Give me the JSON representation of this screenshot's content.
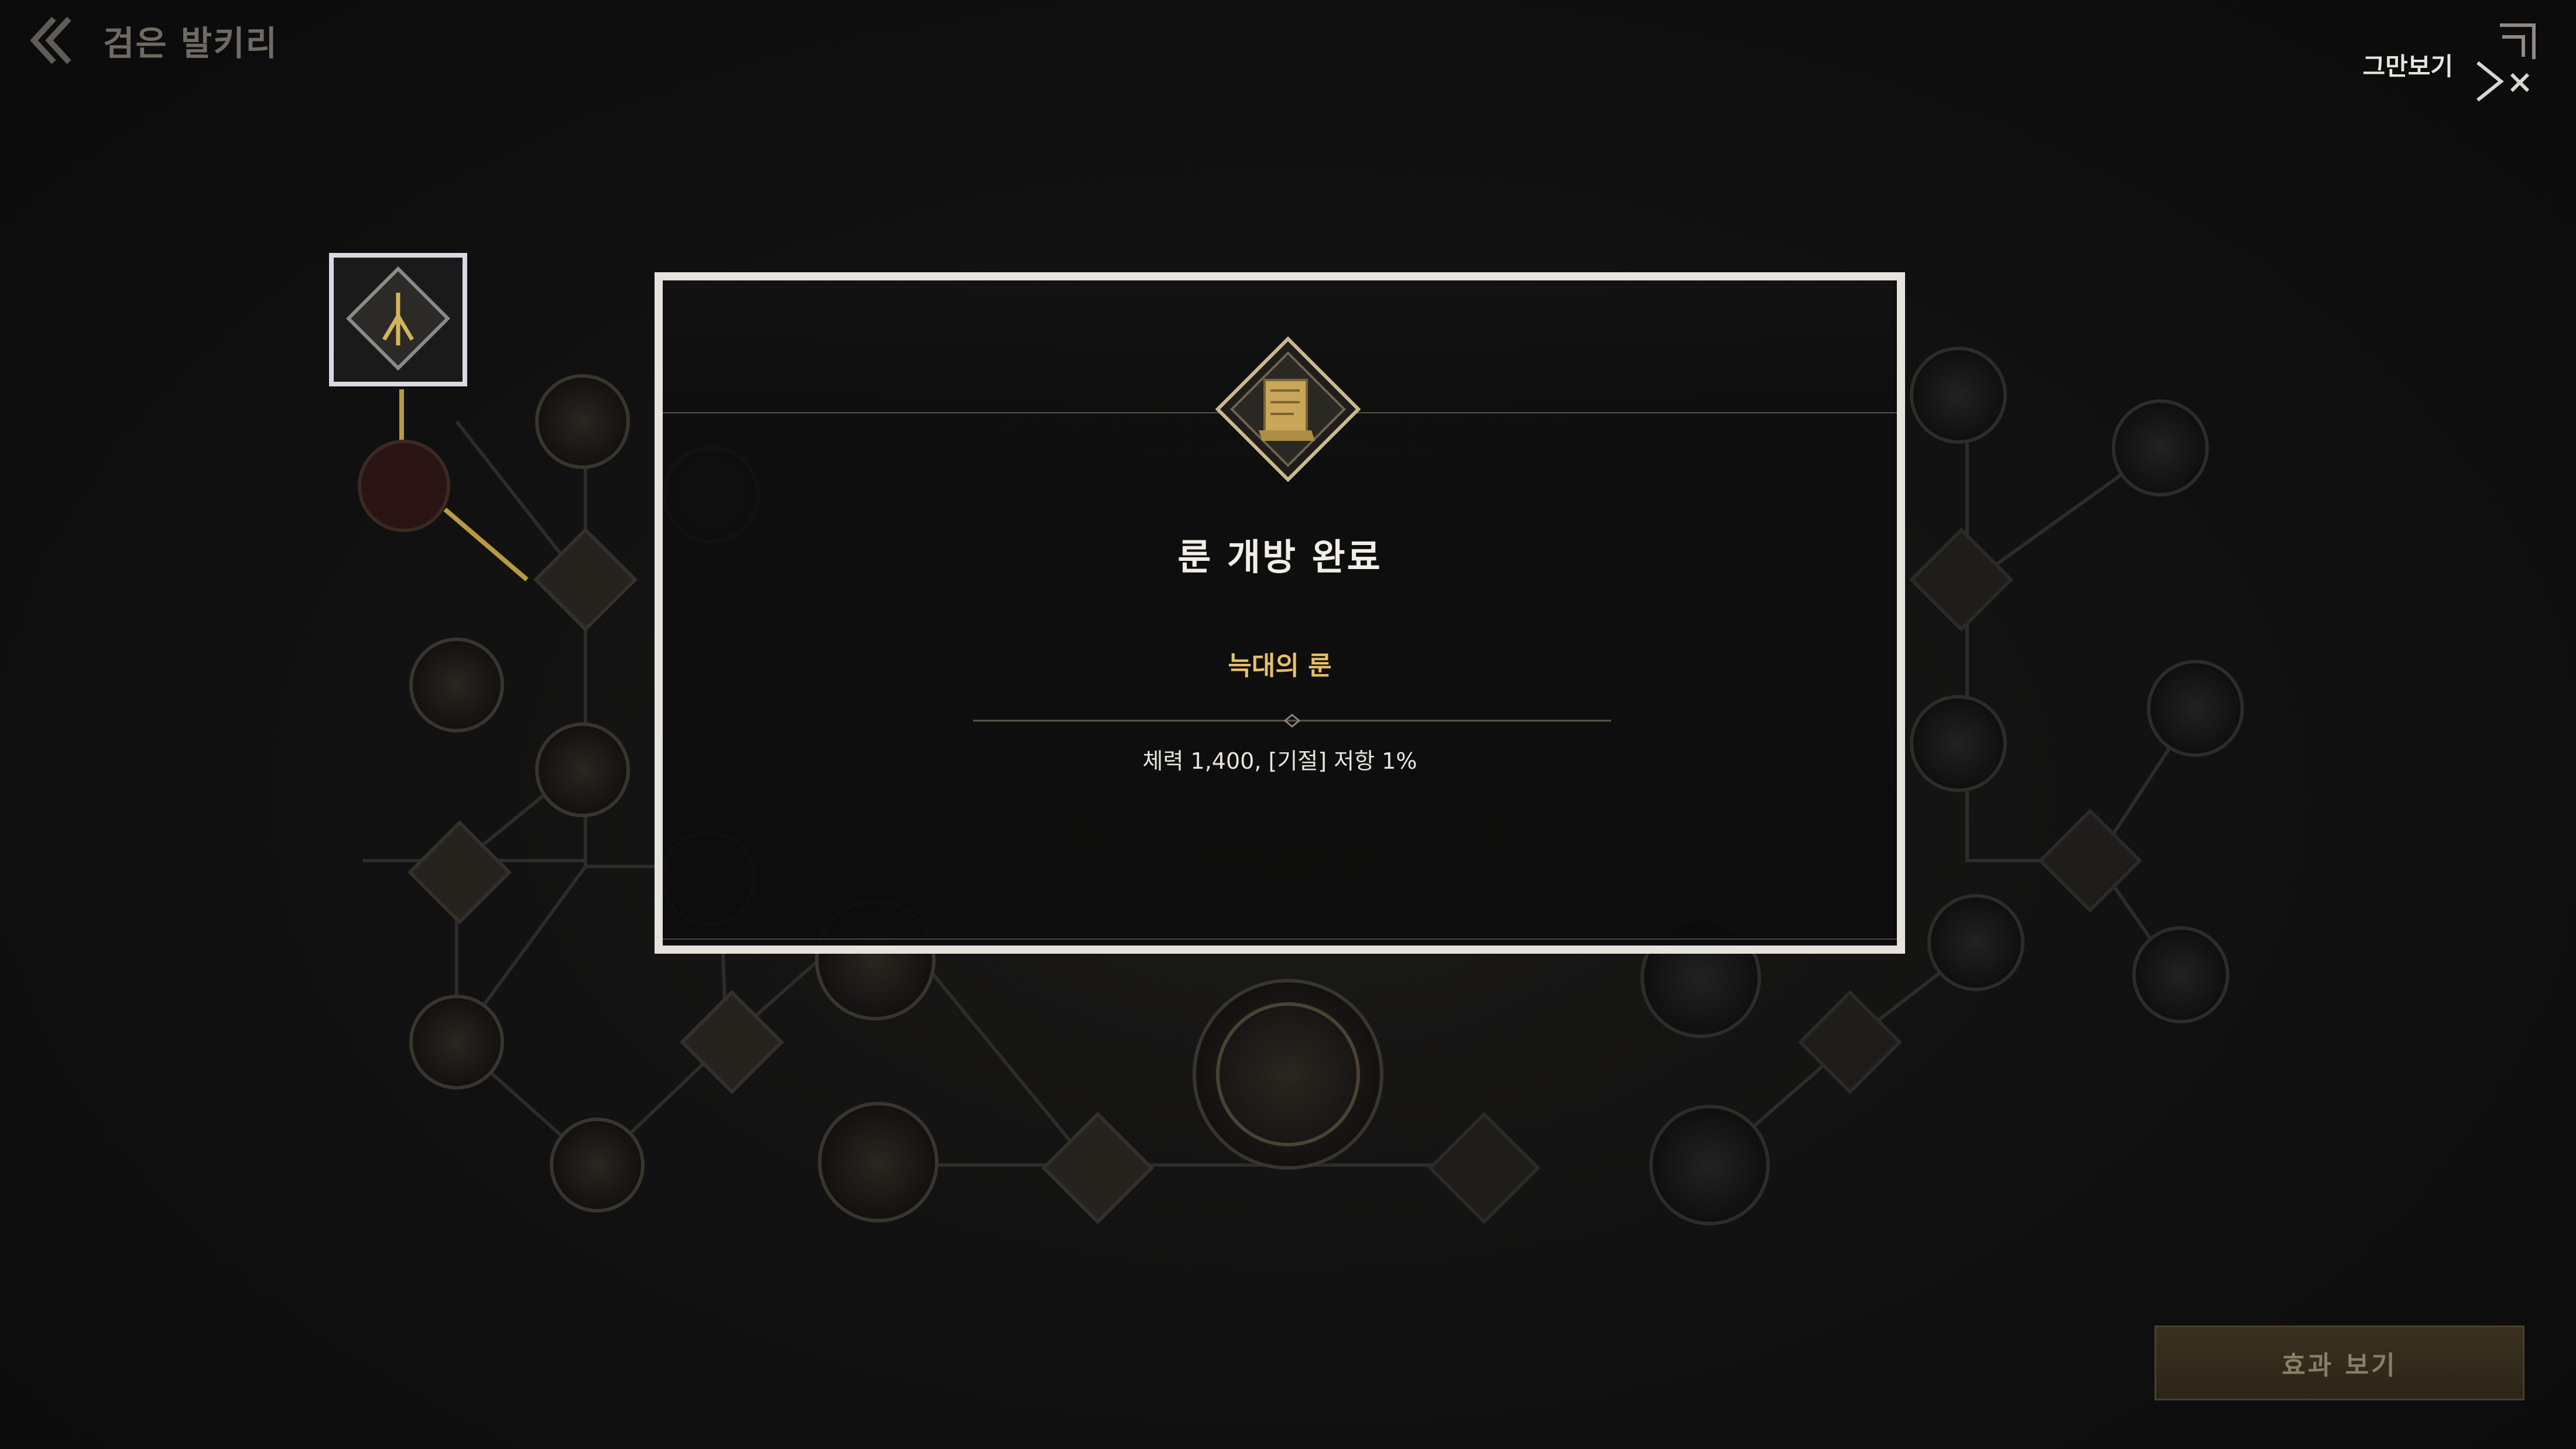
{
  "header": {
    "back_icon": "double-chevron-left-icon",
    "title": "검은 발키리"
  },
  "skip": {
    "label": "그만보기",
    "icon": "skip-arrows-icon"
  },
  "popup": {
    "emblem_icon": "scroll-rune-emblem-icon",
    "title": "룬 개방 완료",
    "rune_name": "늑대의 룬",
    "effect": "체력 1,400, [기절] 저항 1%"
  },
  "buttons": {
    "view_effect": "효과 보기"
  },
  "colors": {
    "accent_gold": "#e7c06a",
    "frame": "#e6e2dc",
    "background": "#121212"
  }
}
